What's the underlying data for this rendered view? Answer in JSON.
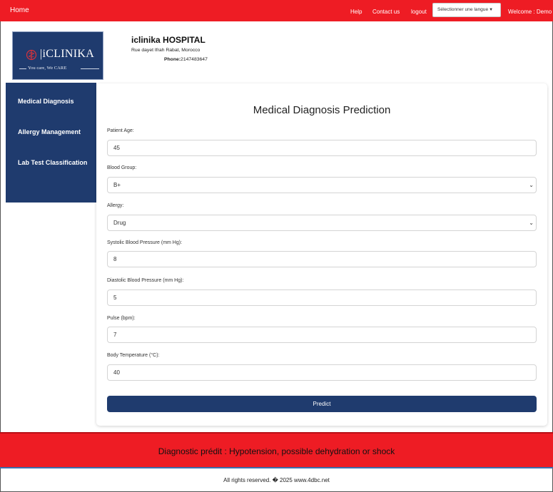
{
  "topbar": {
    "home": "Home",
    "help": "Help",
    "contact": "Contact us",
    "logout": "logout",
    "language_select": "Sélectionner une langue",
    "welcome": "Welcome : Demo"
  },
  "header": {
    "logo_text": "|iCLINIKA",
    "logo_tagline": "You care, We CARE",
    "hospital_name": "iclinika HOSPITAL",
    "address": "Rue dayet Ifrah Rabat, Morocco",
    "phone_label": "Phone:",
    "phone_value": "2147483647"
  },
  "sidebar": {
    "items": [
      {
        "label": "Medical Diagnosis"
      },
      {
        "label": "Allergy Management"
      },
      {
        "label": "Lab Test Classification"
      }
    ]
  },
  "form": {
    "title": "Medical Diagnosis Prediction",
    "fields": [
      {
        "label": "Patient Age:",
        "value": "45"
      },
      {
        "label": "Blood Group:",
        "value": "B+"
      },
      {
        "label": "Allergy:",
        "value": "Drug"
      },
      {
        "label": "Systolic Blood Pressure (mm Hg):",
        "value": "8"
      },
      {
        "label": "Diastolic Blood Pressure (mm Hg):",
        "value": "5"
      },
      {
        "label": "Pulse (bpm):",
        "value": "7"
      },
      {
        "label": "Body Temperature (°C):",
        "value": "40"
      }
    ],
    "predict_label": "Predict"
  },
  "result": {
    "text": "Diagnostic prédit : Hypotension, possible dehydration or shock"
  },
  "footer": {
    "text": "All rights reserved. � 2025 www.4dbc.net"
  },
  "colors": {
    "topbar": "#ee1c24",
    "navy": "#1f3b6e",
    "result_bar": "#ee1c24"
  }
}
